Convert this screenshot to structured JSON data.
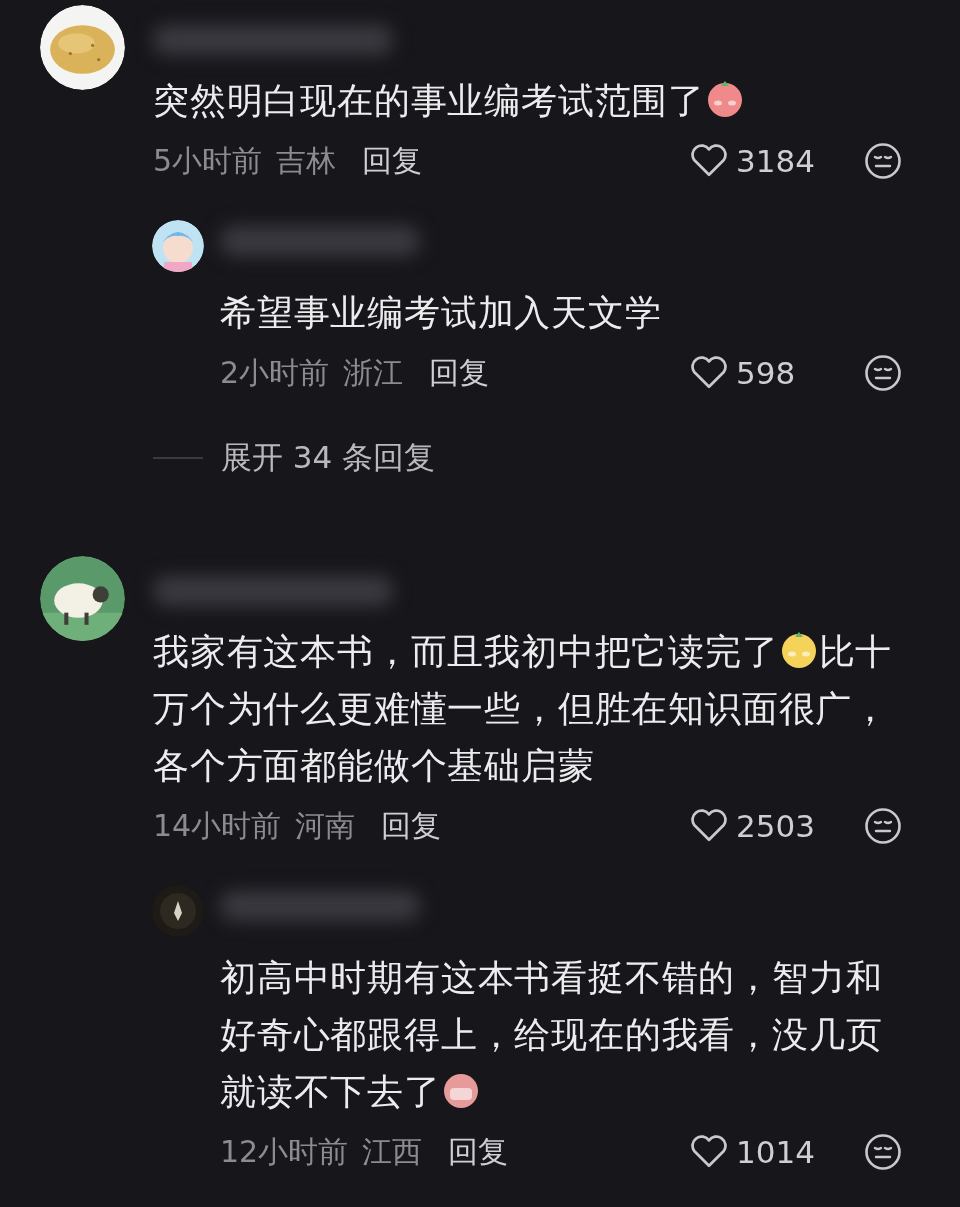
{
  "comments": [
    {
      "avatar": {
        "kind": "picture"
      },
      "lines": [
        [
          {
            "kind": "text",
            "text": "突然明白现在的事业编考试范围了"
          },
          {
            "kind": "emoji",
            "color": "#f08a8a"
          }
        ]
      ],
      "time": "5小时前",
      "location": "吉林",
      "reply_label": "回复",
      "likes": "3184",
      "replies": [
        {
          "avatar": {
            "kind": "picture"
          },
          "lines": [
            [
              {
                "kind": "text",
                "text": "希望事业编考试加入天文学"
              }
            ]
          ],
          "time": "2小时前",
          "location": "浙江",
          "reply_label": "回复",
          "likes": "598"
        }
      ],
      "expand": "展开 34 条回复"
    },
    {
      "avatar": {
        "kind": "picture"
      },
      "lines": [
        [
          {
            "kind": "text",
            "text": "我家有这本书，而且我初中把它读完了"
          },
          {
            "kind": "emoji",
            "color": "#f5d25a"
          },
          {
            "kind": "text",
            "text": "比十"
          }
        ],
        [
          {
            "kind": "text",
            "text": "万个为什么更难懂一些，但胜在知识面很广，各个方面都能做个基础启蒙"
          }
        ]
      ],
      "time": "14小时前",
      "location": "河南",
      "reply_label": "回复",
      "likes": "2503",
      "replies": [
        {
          "avatar": {
            "kind": "picture"
          },
          "lines": [
            [
              {
                "kind": "text",
                "text": "初高中时期有这本书看挺不错的，智力和好奇心都跟得上，给现在的我看，没几页"
              }
            ],
            [
              {
                "kind": "text",
                "text": "就读不下去了"
              },
              {
                "kind": "emoji",
                "color": "#e79a9a"
              }
            ]
          ],
          "time": "12小时前",
          "location": "江西",
          "reply_label": "回复",
          "likes": "1014"
        }
      ]
    }
  ]
}
